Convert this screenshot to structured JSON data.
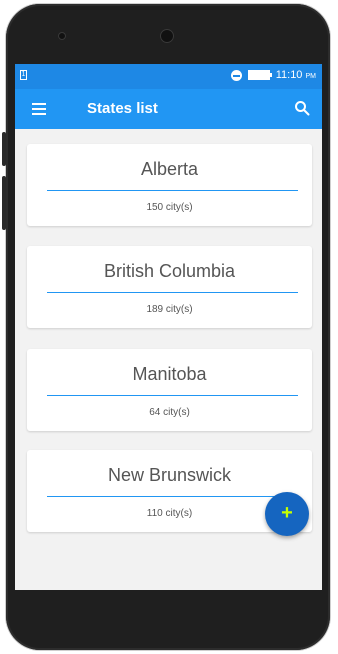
{
  "status_bar": {
    "time": "11:10",
    "ampm": "PM",
    "sim_label": "1"
  },
  "app_bar": {
    "title": "States list"
  },
  "states": [
    {
      "name": "Alberta",
      "count": "150 city(s)"
    },
    {
      "name": "British Columbia",
      "count": "189 city(s)"
    },
    {
      "name": "Manitoba",
      "count": "64 city(s)"
    },
    {
      "name": "New Brunswick",
      "count": "110 city(s)"
    }
  ],
  "fab": {
    "label": "+"
  },
  "colors": {
    "primary": "#2196f3",
    "status_bar": "#1e88e5",
    "fab": "#1565c0",
    "fab_icon": "#c6ff00",
    "divider": "#2196f3"
  },
  "icons": {
    "menu": "hamburger-menu-icon",
    "search": "search-icon",
    "add": "plus-icon"
  }
}
